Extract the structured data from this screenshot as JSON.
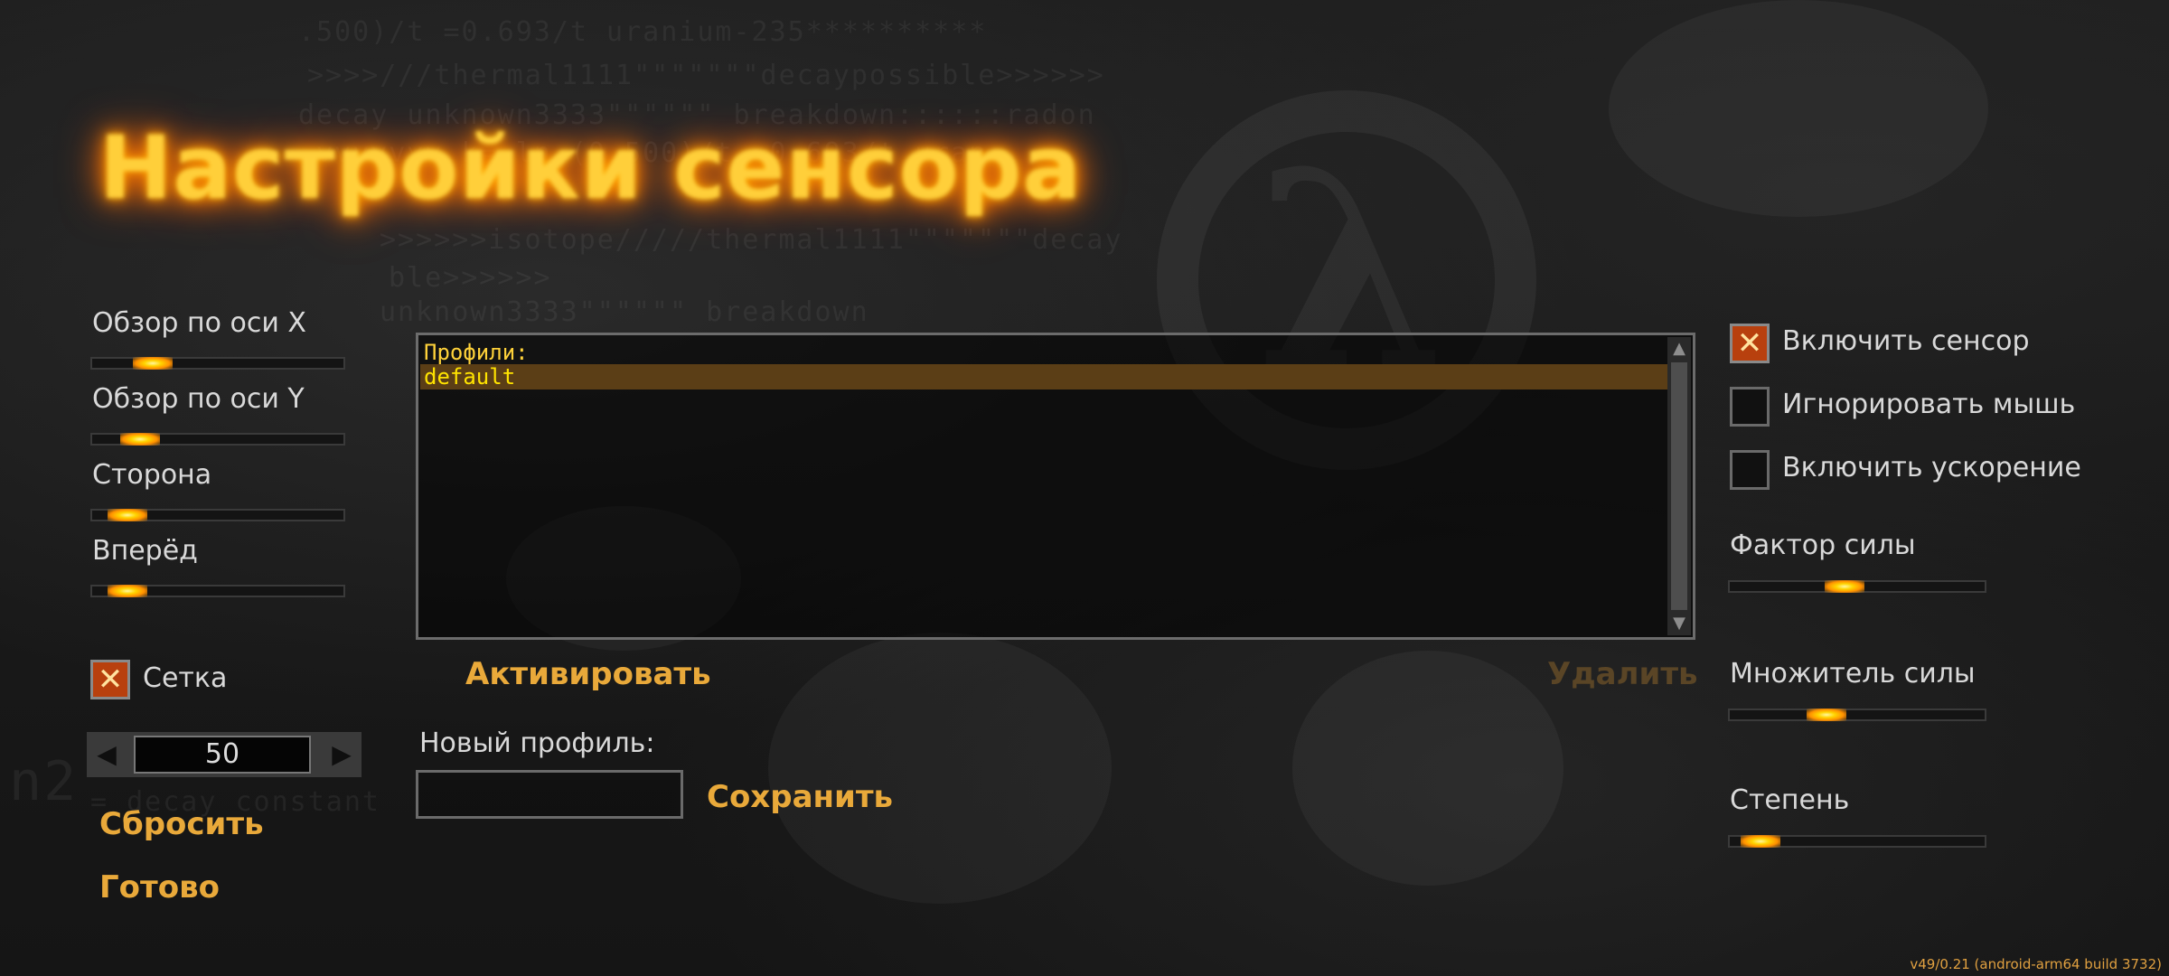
{
  "title": "Настройки сенсора",
  "left_sliders": [
    {
      "label": "Обзор по оси X",
      "value": 0.24
    },
    {
      "label": "Обзор по оси Y",
      "value": 0.19
    },
    {
      "label": "Сторона",
      "value": 0.14
    },
    {
      "label": "Вперёд",
      "value": 0.14
    }
  ],
  "grid": {
    "label": "Сетка",
    "checked": true
  },
  "stepper": {
    "value": "50",
    "decrement_icon": "triangle-left-icon",
    "increment_icon": "triangle-right-icon"
  },
  "actions": {
    "reset": "Сбросить",
    "done": "Готово"
  },
  "profiles": {
    "header": "Профили:",
    "items": [
      "default"
    ],
    "selected": "default",
    "activate": "Активировать",
    "delete": "Удалить",
    "new_profile_label": "Новый профиль:",
    "new_profile_value": "",
    "save": "Сохранить"
  },
  "options": [
    {
      "label": "Включить сенсор",
      "checked": true
    },
    {
      "label": "Игнорировать мышь",
      "checked": false
    },
    {
      "label": "Включить ускорение",
      "checked": false
    }
  ],
  "right_sliders": [
    {
      "label": "Фактор силы",
      "value": 0.45
    },
    {
      "label": "Множитель силы",
      "value": 0.38
    },
    {
      "label": "Степень",
      "value": 0.12
    }
  ],
  "version": "v49/0.21 (android-arm64 build 3732)",
  "colors": {
    "accent": "#e9a93a",
    "title_glow": "#ff8c00",
    "selection": "#5b3e16",
    "list_text": "#ffe300"
  }
}
